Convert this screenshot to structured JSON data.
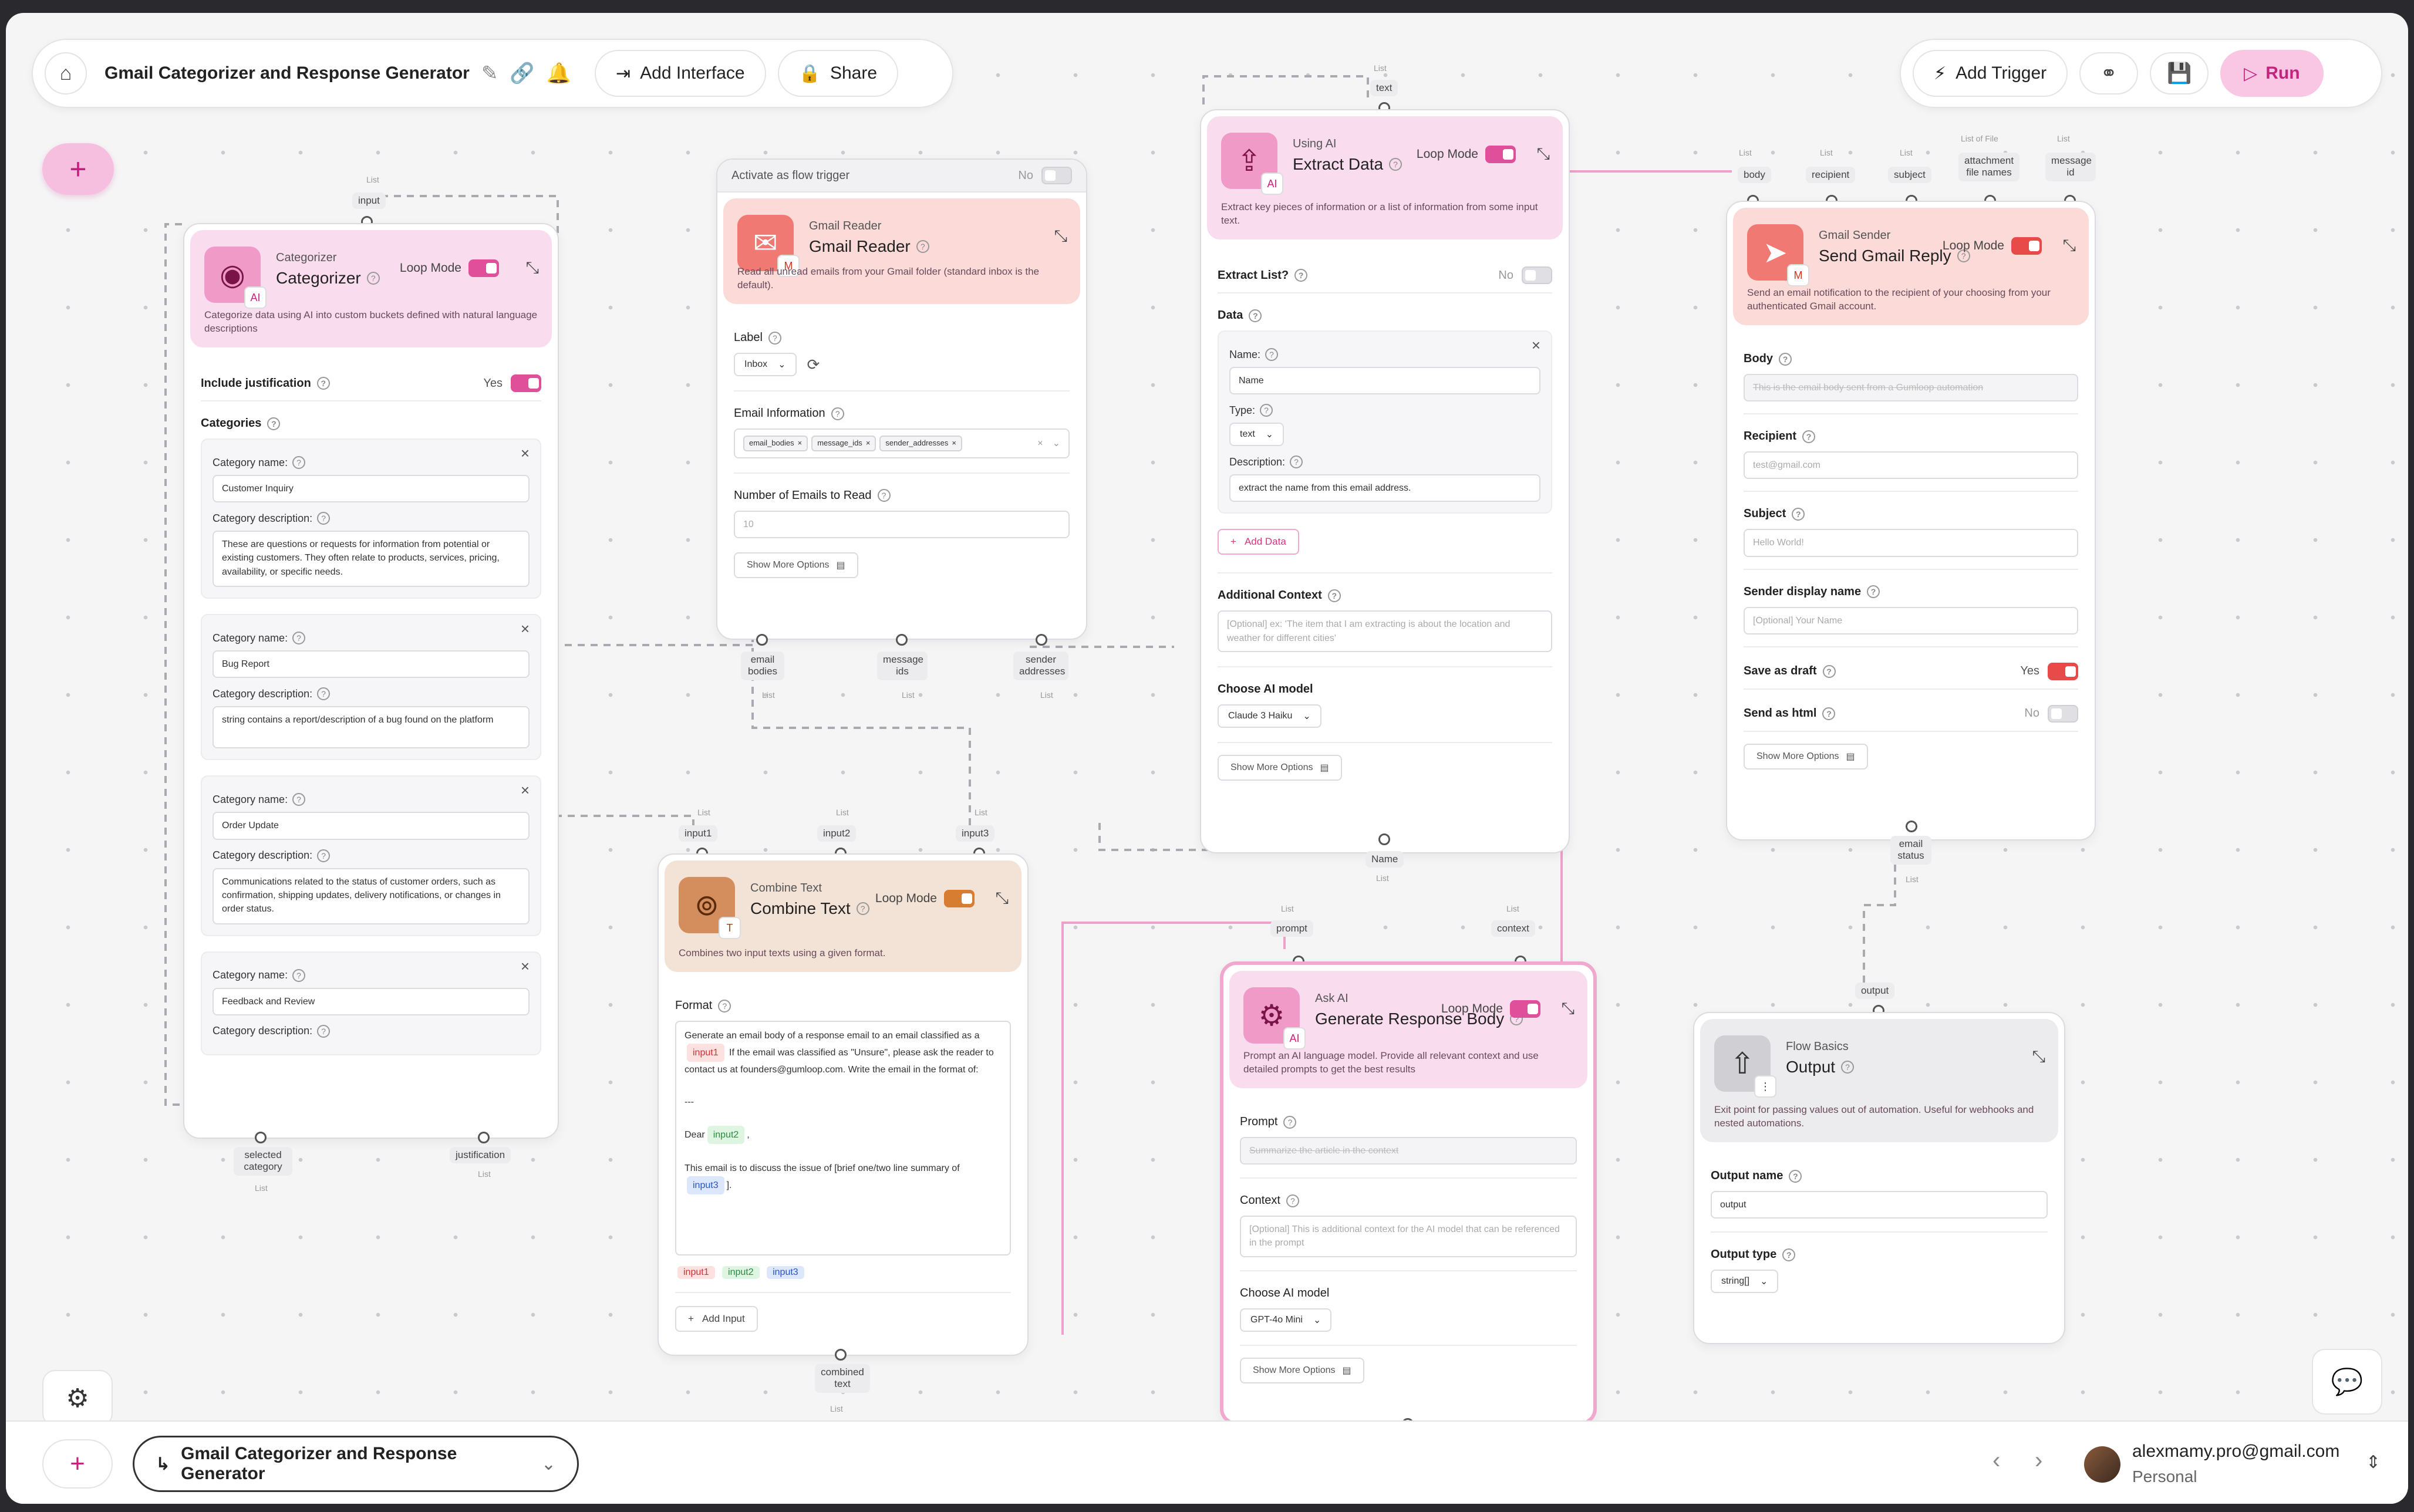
{
  "header": {
    "home_icon": "home-icon",
    "title": "Gmail Categorizer and Response Generator",
    "add_interface": "Add Interface",
    "share": "Share",
    "add_trigger": "Add Trigger",
    "run": "Run"
  },
  "categorizer": {
    "port_top": "input",
    "sub": "Categorizer",
    "title": "Categorizer",
    "loop_label": "Loop Mode",
    "desc": "Categorize data using AI into custom buckets defined with natural language descriptions",
    "include_justification": "Include justification",
    "include_justification_value": "Yes",
    "categories_label": "Categories",
    "name_label": "Category name:",
    "desc_label": "Category description:",
    "categories": [
      {
        "name": "Customer Inquiry",
        "description": "These are questions or requests for information from potential or existing customers. They often relate to products, services, pricing, availability, or specific needs."
      },
      {
        "name": "Bug Report",
        "description": "string contains a report/description of a bug found on the platform"
      },
      {
        "name": "Order Update",
        "description": "Communications related to the status of customer orders, such as confirmation, shipping updates, delivery notifications, or changes in order status."
      },
      {
        "name": "Feedback and Review"
      }
    ],
    "out1": "selected category",
    "out2": "justification"
  },
  "gmail_reader": {
    "trigger_label": "Activate as flow trigger",
    "trigger_value": "No",
    "sub": "Gmail Reader",
    "title": "Gmail Reader",
    "desc": "Read all unread emails from your Gmail folder (standard inbox is the default).",
    "label_label": "Label",
    "label_value": "Inbox",
    "email_info_label": "Email Information",
    "chips": [
      "email_bodies",
      "message_ids",
      "sender_addresses"
    ],
    "num_label": "Number of Emails to Read",
    "num_placeholder": "10",
    "more": "Show More Options",
    "out1": "email bodies",
    "out2": "message ids",
    "out3": "sender addresses"
  },
  "combine": {
    "in1": "input1",
    "in2": "input2",
    "in3": "input3",
    "sub": "Combine Text",
    "title": "Combine Text",
    "loop_label": "Loop Mode",
    "desc": "Combines two input texts using a given format.",
    "format_label": "Format",
    "format_line1": "Generate an email body of a response email to an email classified as a",
    "format_line2": "If the email was classified as \"Unsure\", please ask the reader to contact us at founders@gumloop.com. Write the email in the format of:",
    "format_dash": "---",
    "format_dear": "Dear",
    "format_line3": "This email is to discuss the issue of [brief one/two line summary of",
    "add_input": "Add Input",
    "out": "combined text"
  },
  "extract": {
    "port_top": "text",
    "sub": "Using AI",
    "title": "Extract Data",
    "loop_label": "Loop Mode",
    "desc": "Extract key pieces of information or a list of information from some input text.",
    "extract_list": "Extract List?",
    "extract_list_value": "No",
    "data_label": "Data",
    "name_label": "Name:",
    "name_value": "Name",
    "type_label": "Type:",
    "type_value": "text",
    "description_label": "Description:",
    "description_value": "extract the name from this email address.",
    "add_data": "Add Data",
    "context_label": "Additional Context",
    "context_placeholder": "[Optional] ex: 'The item that I am extracting is about the location and weather for different cities'",
    "model_label": "Choose AI model",
    "model_value": "Claude 3 Haiku",
    "more": "Show More Options",
    "out": "Name"
  },
  "askai": {
    "in1": "prompt",
    "in2": "context",
    "sub": "Ask AI",
    "title": "Generate Response Body",
    "loop_label": "Loop Mode",
    "desc": "Prompt an AI language model. Provide all relevant context and use detailed prompts to get the best results",
    "prompt_label": "Prompt",
    "prompt_placeholder": "Summarize the article in the context",
    "context_label": "Context",
    "context_placeholder": "[Optional] This is additional context for the AI model that can be referenced in the prompt",
    "model_label": "Choose AI model",
    "model_value": "GPT-4o Mini",
    "more": "Show More Options"
  },
  "gmail_sender": {
    "ports": [
      "body",
      "recipient",
      "subject",
      "attachment file names",
      "message id"
    ],
    "ports_top": [
      "List",
      "List",
      "List",
      "List of File",
      "List"
    ],
    "sub": "Gmail Sender",
    "title": "Send Gmail Reply",
    "loop_label": "Loop Mode",
    "desc": "Send an email notification to the recipient of your choosing from your authenticated Gmail account.",
    "body_label": "Body",
    "body_placeholder": "This is the email body sent from a Gumloop automation",
    "recipient_label": "Recipient",
    "recipient_placeholder": "test@gmail.com",
    "subject_label": "Subject",
    "subject_placeholder": "Hello World!",
    "sender_label": "Sender display name",
    "sender_placeholder": "[Optional] Your Name",
    "draft_label": "Save as draft",
    "draft_value": "Yes",
    "html_label": "Send as html",
    "html_value": "No",
    "more": "Show More Options",
    "out": "email status"
  },
  "output": {
    "in": "output",
    "sub": "Flow Basics",
    "title": "Output",
    "desc": "Exit point for passing values out of automation. Useful for webhooks and nested automations.",
    "name_label": "Output name",
    "name_value": "output",
    "type_label": "Output type",
    "type_value": "string[]"
  },
  "list_tag": "List",
  "ai_badge": "AI",
  "footer": {
    "flow_name": "Gmail Categorizer and Response Generator",
    "email": "alexmamy.pro@gmail.com",
    "workspace": "Personal"
  }
}
